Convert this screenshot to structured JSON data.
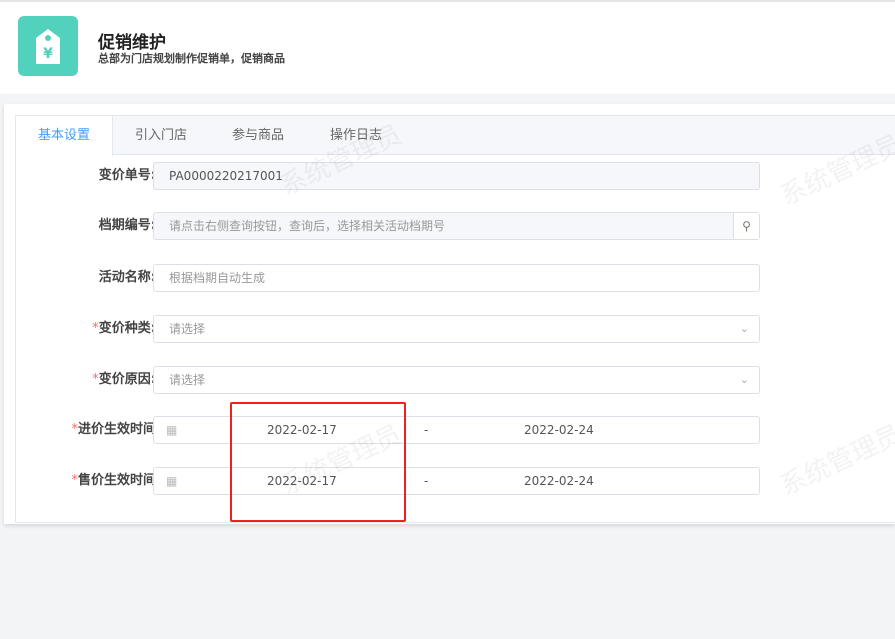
{
  "header": {
    "title": "促销维护",
    "subtitle": "总部为门店规划制作促销单，促销商品",
    "icon": "price-tag-yen-icon"
  },
  "tabs": [
    {
      "label": "基本设置"
    },
    {
      "label": "引入门店"
    },
    {
      "label": "参与商品"
    },
    {
      "label": "操作日志"
    }
  ],
  "form": {
    "order_no": {
      "label": "变价单号:",
      "value": "PA0000220217001"
    },
    "period_no": {
      "label": "档期编号:",
      "placeholder": "请点击右侧查询按钮，查询后，选择相关活动档期号"
    },
    "activity_name": {
      "label": "活动名称:",
      "placeholder": "根据档期自动生成"
    },
    "price_type": {
      "label": "变价种类:",
      "placeholder": "请选择"
    },
    "price_reason": {
      "label": "变价原因:",
      "placeholder": "请选择"
    },
    "purchase_time": {
      "label": "进价生效时间",
      "start": "2022-02-17",
      "sep": "-",
      "end": "2022-02-24"
    },
    "sale_time": {
      "label": "售价生效时间",
      "start": "2022-02-17",
      "sep": "-",
      "end": "2022-02-24"
    },
    "required_mark": "*"
  },
  "watermark": "系统管理员"
}
